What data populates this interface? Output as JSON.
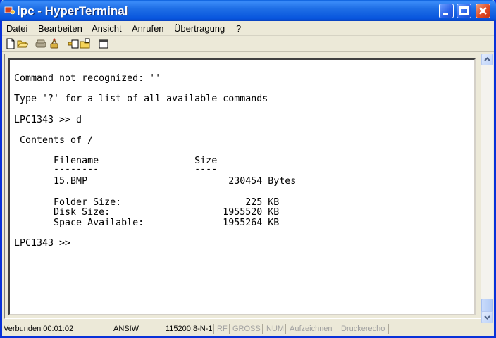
{
  "window": {
    "title": "lpc - HyperTerminal"
  },
  "menu": [
    "Datei",
    "Bearbeiten",
    "Ansicht",
    "Anrufen",
    "Übertragung",
    "?"
  ],
  "toolbar": [
    "new-icon",
    "open-icon",
    "connect-icon",
    "disconnect-icon",
    "send-icon",
    "receive-icon",
    "properties-icon"
  ],
  "terminal": {
    "lines": [
      "Command not recognized: ''",
      "Type '?' for a list of all available commands",
      "LPC1343 >> d",
      " Contents of /",
      "       Filename                 Size",
      "       --------                 ----",
      "       15.BMP                         230454 Bytes",
      "       Folder Size:                      225 KB",
      "       Disk Size:                    1955520 KB",
      "       Space Available:              1955264 KB",
      "LPC1343 >>"
    ]
  },
  "status": {
    "connected": "Verbunden 00:01:02",
    "emulation": "ANSIW",
    "port_settings": "115200 8-N-1",
    "rf": "RF",
    "gross": "GROSS",
    "num": "NUM",
    "capture": "Aufzeichnen",
    "printer_echo": "Druckerecho"
  }
}
